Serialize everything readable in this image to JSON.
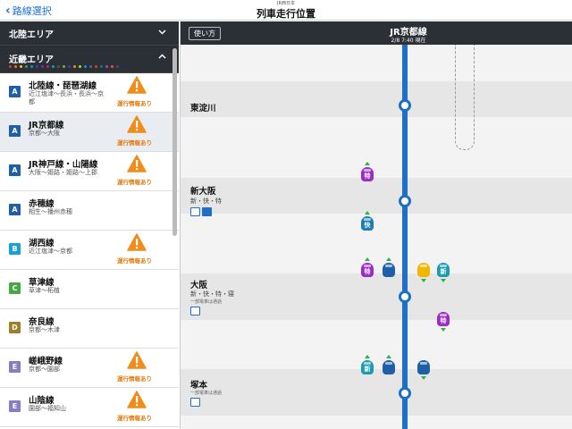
{
  "topbar": {
    "back_label": "路線選択",
    "subtitle": "JR西日本",
    "title": "列車走行位置"
  },
  "areas": [
    {
      "name": "北陸エリア",
      "expanded": false
    },
    {
      "name": "近畿エリア",
      "expanded": true
    }
  ],
  "area_dot_colors": [
    "#e53935",
    "#f57c00",
    "#fbc02d",
    "#43a047",
    "#1e88e5",
    "#3949ab",
    "#8e24aa",
    "#d81b60",
    "#00acc1",
    "#6d4c41",
    "#7cb342",
    "#5e35b1",
    "#fb8c00",
    "#c0ca33",
    "#039be5",
    "#546e7a",
    "#e53935",
    "#00897b",
    "#ab47bc",
    "#f4511e",
    "#3949ab"
  ],
  "lines": [
    {
      "symbol": "A",
      "color": "#1f5fa8",
      "name": "北陸線・琵琶湖線",
      "section": "近江塩津～長浜・長浜～京都",
      "warning": true,
      "selected": false
    },
    {
      "symbol": "A",
      "color": "#1f5fa8",
      "name": "JR京都線",
      "section": "京都～大阪",
      "warning": true,
      "selected": true
    },
    {
      "symbol": "A",
      "color": "#1f5fa8",
      "name": "JR神戸線・山陽線",
      "section": "大阪～姫路・姫路～上郡",
      "warning": true,
      "selected": false
    },
    {
      "symbol": "A",
      "color": "#1f5fa8",
      "name": "赤穂線",
      "section": "相生～播州赤穂",
      "warning": false,
      "selected": false
    },
    {
      "symbol": "B",
      "color": "#1aa0d8",
      "name": "湖西線",
      "section": "近江塩津～京都",
      "warning": true,
      "selected": false
    },
    {
      "symbol": "C",
      "color": "#46a944",
      "name": "草津線",
      "section": "草津～柘植",
      "warning": false,
      "selected": false
    },
    {
      "symbol": "D",
      "color": "#a17c2b",
      "name": "奈良線",
      "section": "京都～木津",
      "warning": false,
      "selected": false
    },
    {
      "symbol": "E",
      "color": "#8a7cc2",
      "name": "嵯峨野線",
      "section": "京都～園部",
      "warning": true,
      "selected": false
    },
    {
      "symbol": "E",
      "color": "#8a7cc2",
      "name": "山陰線",
      "section": "園部～福知山",
      "warning": true,
      "selected": false
    }
  ],
  "warning_label": "運行情報あり",
  "main": {
    "help_label": "使い方",
    "line_title": "JR京都線",
    "time": "2/8 7:40 現在",
    "track_color": "#1f6fc5"
  },
  "stations": [
    {
      "name": "東淀川",
      "stops": "",
      "note": ""
    },
    {
      "name": "新大阪",
      "stops": "新・快・特",
      "note": ""
    },
    {
      "name": "大阪",
      "stops": "新・快・特・寝",
      "note": "一部電車は通過"
    },
    {
      "name": "塚本",
      "stops": "",
      "note": "一部電車は通過"
    }
  ],
  "trains": [
    {
      "label": "特",
      "color": "#9b2bc4",
      "direction": "up"
    },
    {
      "label": "快",
      "color": "#1a7fb0",
      "direction": "up"
    },
    {
      "label": "特",
      "color": "#9b2bc4",
      "direction": "up"
    },
    {
      "label": "",
      "color": "#1f5fa8",
      "direction": "up"
    },
    {
      "label": "",
      "color": "#f2b600",
      "direction": "down"
    },
    {
      "label": "新",
      "color": "#1a9bb0",
      "direction": "down"
    },
    {
      "label": "特",
      "color": "#9b2bc4",
      "direction": "down"
    },
    {
      "label": "新",
      "color": "#1a9bb0",
      "direction": "up"
    },
    {
      "label": "",
      "color": "#1f5fa8",
      "direction": "up"
    },
    {
      "label": "",
      "color": "#1f5fa8",
      "direction": "down"
    }
  ]
}
